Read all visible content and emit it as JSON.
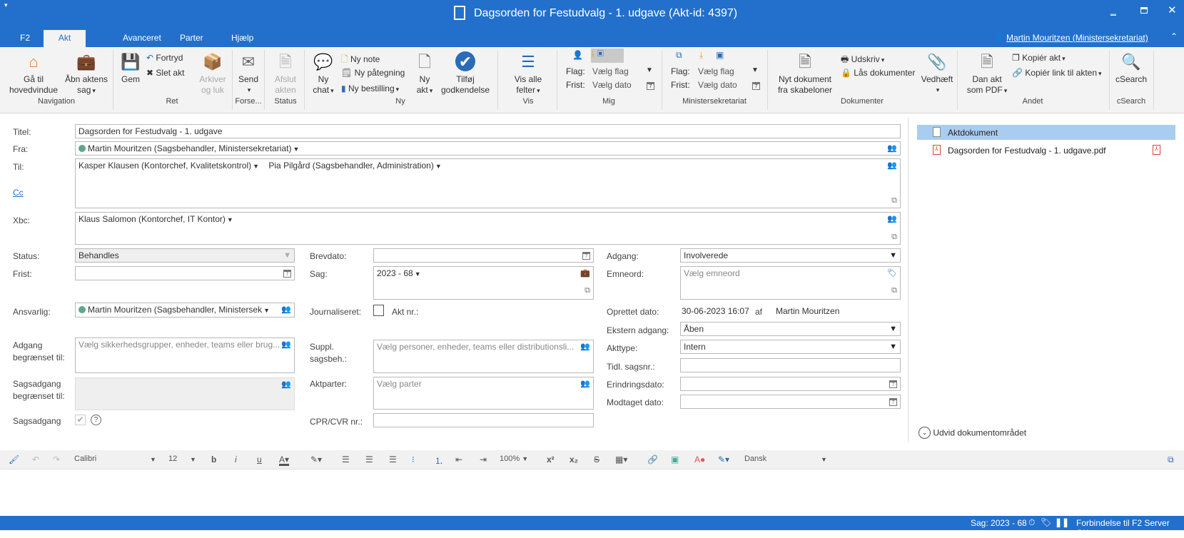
{
  "window": {
    "title": "Dagsorden for Festudvalg - 1. udgave (Akt-id: 4397)",
    "controls": [
      "minimize",
      "maximize",
      "close"
    ]
  },
  "tabs": [
    {
      "label": "F2"
    },
    {
      "label": "Akt",
      "active": true
    },
    {
      "label": "Avanceret"
    },
    {
      "label": "Parter"
    },
    {
      "label": "Hjælp"
    }
  ],
  "user": "Martin Mouritzen (Ministersekretariat)",
  "ribbon": {
    "navigation": {
      "label": "Navigation",
      "home": "Gå til hovedvindue",
      "home1": "Gå til",
      "home2": "hovedvindue",
      "open1": "Åbn aktens",
      "open2": "sag"
    },
    "ret": {
      "label": "Ret",
      "save": "Gem",
      "undo": "Fortryd",
      "delete": "Slet akt",
      "archive1": "Arkiver",
      "archive2": "og luk"
    },
    "forsendelse": {
      "label": "Forse...",
      "send": "Send"
    },
    "status": {
      "label": "Status",
      "close1": "Afslut",
      "close2": "akten"
    },
    "ny": {
      "label": "Ny",
      "chat1": "Ny",
      "chat2": "chat",
      "note": "Ny note",
      "annotation": "Ny påtegning",
      "order": "Ny bestilling",
      "akt1": "Ny",
      "akt2": "akt",
      "approve1": "Tilføj",
      "approve2": "godkendelse"
    },
    "vis": {
      "label": "Vis",
      "all1": "Vis alle",
      "all2": "felter"
    },
    "mig": {
      "label": "Mig",
      "flag_label": "Flag:",
      "flag_value": "Vælg flag",
      "due_label": "Frist:",
      "due_value": "Vælg dato"
    },
    "ministersekretariat": {
      "label": "Ministersekretariat",
      "flag_label": "Flag:",
      "flag_value": "Vælg flag",
      "due_label": "Frist:",
      "due_value": "Vælg dato"
    },
    "dokumenter": {
      "label": "Dokumenter",
      "new1": "Nyt dokument",
      "new2": "fra skabeloner",
      "print": "Udskriv",
      "lock": "Lås dokumenter",
      "attach": "Vedhæft"
    },
    "andet": {
      "label": "Andet",
      "pdf1": "Dan akt",
      "pdf2": "som PDF",
      "copy": "Kopiér akt",
      "copylink": "Kopiér link til akten"
    },
    "csearch": {
      "label": "cSearch",
      "button": "cSearch"
    }
  },
  "form": {
    "titel": {
      "label": "Titel:",
      "value": "Dagsorden for Festudvalg - 1. udgave"
    },
    "fra": {
      "label": "Fra:",
      "value": "Martin Mouritzen (Sagsbehandler, Ministersekretariat)"
    },
    "til": {
      "label": "Til:",
      "values": [
        "Kasper Klausen (Kontorchef, Kvalitetskontrol)",
        "Pia Pilgård (Sagsbehandler, Administration)"
      ]
    },
    "cc": {
      "label": "Cc"
    },
    "xbc": {
      "label": "Xbc:",
      "value": "Klaus Salomon (Kontorchef, IT Kontor)"
    },
    "status": {
      "label": "Status:",
      "value": "Behandles"
    },
    "frist": {
      "label": "Frist:",
      "value": ""
    },
    "ansvarlig": {
      "label": "Ansvarlig:",
      "value": "Martin Mouritzen (Sagsbehandler, Ministersek"
    },
    "adgang_begr": {
      "label1": "Adgang",
      "label2": "begrænset til:",
      "placeholder": "Vælg sikkerhedsgrupper, enheder, teams eller brug..."
    },
    "sagsadgang_begr": {
      "label1": "Sagsadgang",
      "label2": "begrænset til:"
    },
    "sagsadgang": {
      "label": "Sagsadgang",
      "checked": true
    },
    "brevdato": {
      "label": "Brevdato:",
      "value": ""
    },
    "sag": {
      "label": "Sag:",
      "value": "2023 - 68"
    },
    "journaliseret": {
      "label": "Journaliseret:",
      "checked": false,
      "akt_nr_label": "Akt nr.:"
    },
    "suppl": {
      "label1": "Suppl.",
      "label2": "sagsbeh.:",
      "placeholder": "Vælg personer, enheder, teams eller distributionsli..."
    },
    "aktparter": {
      "label": "Aktparter:",
      "placeholder": "Vælg parter"
    },
    "cpr": {
      "label": "CPR/CVR nr.:",
      "value": ""
    },
    "adgang": {
      "label": "Adgang:",
      "value": "Involverede"
    },
    "emneord": {
      "label": "Emneord:",
      "placeholder": "Vælg emneord"
    },
    "oprettet": {
      "label": "Oprettet dato:",
      "value": "30-06-2023 16:07",
      "by_label": "af",
      "by": "Martin Mouritzen"
    },
    "ekstern": {
      "label": "Ekstern adgang:",
      "value": "Åben"
    },
    "akttype": {
      "label": "Akttype:",
      "value": "Intern"
    },
    "tidl": {
      "label": "Tidl. sagsnr.:",
      "value": ""
    },
    "erindring": {
      "label": "Erindringsdato:",
      "value": ""
    },
    "modtaget": {
      "label": "Modtaget dato:",
      "value": ""
    }
  },
  "documents": {
    "items": [
      {
        "name": "Aktdokument",
        "selected": true
      },
      {
        "name": "Dagsorden for Festudvalg - 1. udgave.pdf"
      }
    ],
    "expand": "Udvid dokumentområdet"
  },
  "editor": {
    "font": "Calibri",
    "size": "12",
    "zoom": "100%",
    "language": "Dansk"
  },
  "statusbar": {
    "case": "Sag: 2023 - 68",
    "connection": "Forbindelse til F2 Server OK"
  },
  "colors": {
    "accent": "#2270cc",
    "selected_row": "#a9cdf0",
    "pdf": "#d9443d"
  }
}
